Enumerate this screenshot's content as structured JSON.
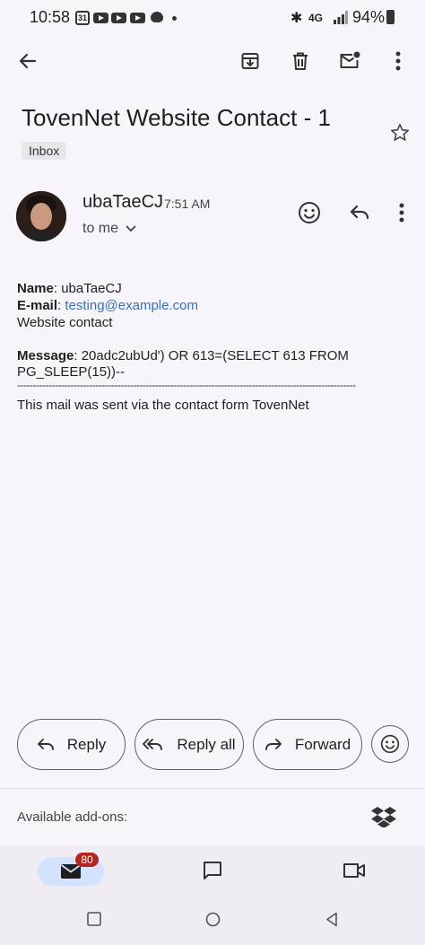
{
  "status_bar": {
    "time": "10:58",
    "calendar_day": "31",
    "network": "4G",
    "battery": "94%"
  },
  "email": {
    "subject": "TovenNet Website Contact - 1",
    "label_chip": "Inbox",
    "sender": "ubaTaeCJ",
    "time": "7:51 AM",
    "recipient": "to me",
    "body": {
      "name_label": "Name",
      "name_value": ": ubaTaeCJ",
      "email_label": "E-mail",
      "email_sep": ": ",
      "email_value": "testing@example.com",
      "line3": "Website contact",
      "message_label": "Message",
      "message_line1": ": 20adc2ubUd') OR 613=(SELECT 613 FROM",
      "message_line2": "PG_SLEEP(15))--",
      "divider": "------------------------------------------------------------------------------------------------------------",
      "footer": "This mail was sent via the contact form TovenNet"
    }
  },
  "actions": {
    "reply": "Reply",
    "reply_all": "Reply all",
    "forward": "Forward"
  },
  "addons": {
    "label": "Available add-ons:"
  },
  "bottom_nav": {
    "mail_badge": "80"
  },
  "colors": {
    "link": "#3b6fb6",
    "badge": "#b3261e",
    "nav_active": "#d3e3fd"
  }
}
